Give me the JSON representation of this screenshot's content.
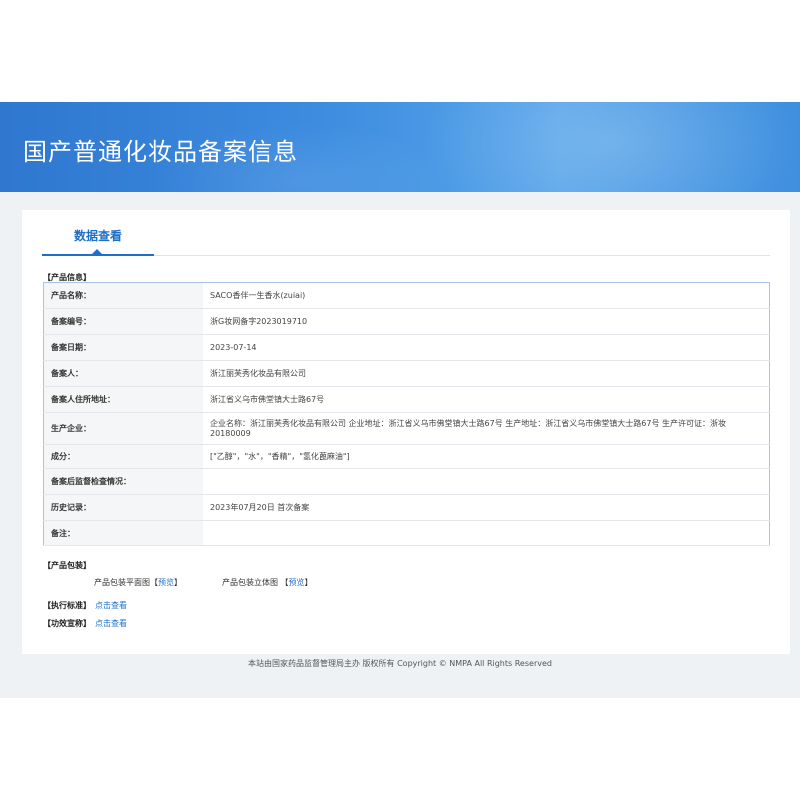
{
  "header": {
    "title": "国产普通化妆品备案信息"
  },
  "tabs": [
    {
      "label": "数据查看",
      "active": true
    }
  ],
  "product_section": {
    "title": "【产品信息】",
    "rows": [
      {
        "label": "产品名称：",
        "value": "SACO香伴一生香水(zuiai)"
      },
      {
        "label": "备案编号：",
        "value": "浙G妆网备字2023019710"
      },
      {
        "label": "备案日期：",
        "value": "2023-07-14"
      },
      {
        "label": "备案人：",
        "value": "浙江丽芙秀化妆品有限公司"
      },
      {
        "label": "备案人住所地址：",
        "value": "浙江省义乌市佛堂镇大士路67号"
      },
      {
        "label": "生产企业：",
        "value": "企业名称：浙江丽芙秀化妆品有限公司 企业地址：浙江省义乌市佛堂镇大士路67号 生产地址：浙江省义乌市佛堂镇大士路67号 生产许可证：浙妆 20180009"
      },
      {
        "label": "成分：",
        "value": "[\"乙醇\"，\"水\"，\"香精\"，\"氢化蓖麻油\"]"
      },
      {
        "label": "备案后监督检查情况：",
        "value": ""
      },
      {
        "label": "历史记录：",
        "value": "2023年07月20日 首次备案"
      },
      {
        "label": "备注：",
        "value": ""
      }
    ]
  },
  "packaging": {
    "title": "【产品包装】",
    "flat_label": "产品包装平面图【",
    "flat_link": "预览",
    "flat_end": "】",
    "solid_label": "产品包装立体图 【",
    "solid_link": "预览",
    "solid_end": "】"
  },
  "standard": {
    "title": "【执行标准】",
    "link": "点击查看"
  },
  "effect": {
    "title": "【功效宣称】",
    "link": "点击查看"
  },
  "footer": {
    "text": "本站由国家药品监督管理局主办 版权所有 Copyright © NMPA All Rights Reserved"
  },
  "colors": {
    "banner": "#3a86dc",
    "accent": "#1e6fc8",
    "table_border": "#a9c3e6",
    "background": "#eef2f5"
  }
}
